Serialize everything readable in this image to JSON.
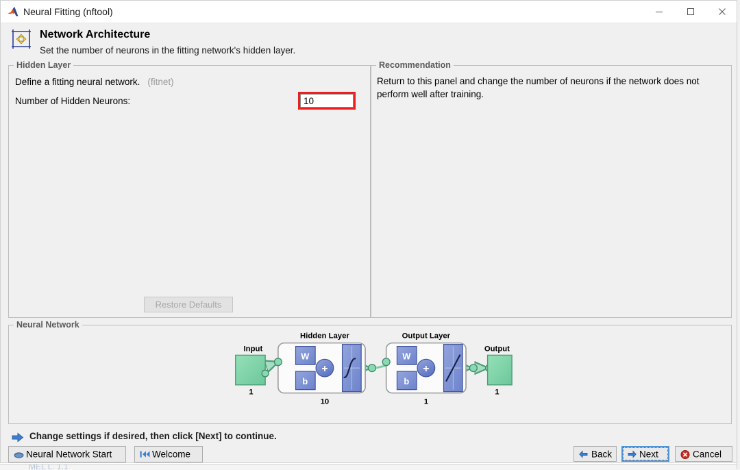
{
  "window": {
    "title": "Neural Fitting (nftool)",
    "app_icon": "matlab-logo-icon",
    "controls": {
      "minimize": "minimize-icon",
      "maximize": "maximize-icon",
      "close": "close-icon"
    }
  },
  "header": {
    "icon": "network-architecture-icon",
    "title": "Network Architecture",
    "subtitle": "Set the number of neurons in the fitting network's hidden layer."
  },
  "hidden_layer_panel": {
    "group_title": "Hidden Layer",
    "define_text": "Define a fitting neural network.",
    "function_name": "(fitnet)",
    "neurons_label": "Number of Hidden Neurons:",
    "neurons_value": "10",
    "restore_defaults_label": "Restore Defaults",
    "restore_defaults_enabled": false
  },
  "recommendation_panel": {
    "group_title": "Recommendation",
    "text": "Return to this panel and change the number of neurons if the network does not perform well after training."
  },
  "neural_network_panel": {
    "group_title": "Neural Network",
    "diagram": {
      "input": {
        "label": "Input",
        "size": "1"
      },
      "hidden_layer": {
        "label": "Hidden Layer",
        "size": "10",
        "weight_label": "W",
        "bias_label": "b",
        "sum_label": "+",
        "transfer_function": "tansig-sigmoid-icon"
      },
      "output_layer": {
        "label": "Output Layer",
        "size": "1",
        "weight_label": "W",
        "bias_label": "b",
        "sum_label": "+",
        "transfer_function": "purelin-linear-icon"
      },
      "output": {
        "label": "Output",
        "size": "1"
      }
    }
  },
  "footer": {
    "hint_icon": "blue-right-arrow-icon",
    "hint_text": "Change settings  if desired, then click [Next] to continue.",
    "buttons": {
      "nn_start": {
        "label": "Neural Network Start",
        "icon": "nn-start-icon"
      },
      "welcome": {
        "label": "Welcome",
        "icon": "rewind-icon"
      },
      "back": {
        "label": "Back",
        "icon": "left-arrow-icon"
      },
      "next": {
        "label": "Next",
        "icon": "right-arrow-icon",
        "focused": true
      },
      "cancel": {
        "label": "Cancel",
        "icon": "cancel-icon"
      }
    }
  },
  "colors": {
    "accent_red": "#ef1f1f",
    "diagram_green": "#7fd6a8",
    "diagram_blue": "#7a8fd4",
    "focus_blue": "#4f94d4",
    "window_bg": "#f0f0f0"
  },
  "background_window": {
    "ghost_text": "MEL L. 1.1"
  }
}
